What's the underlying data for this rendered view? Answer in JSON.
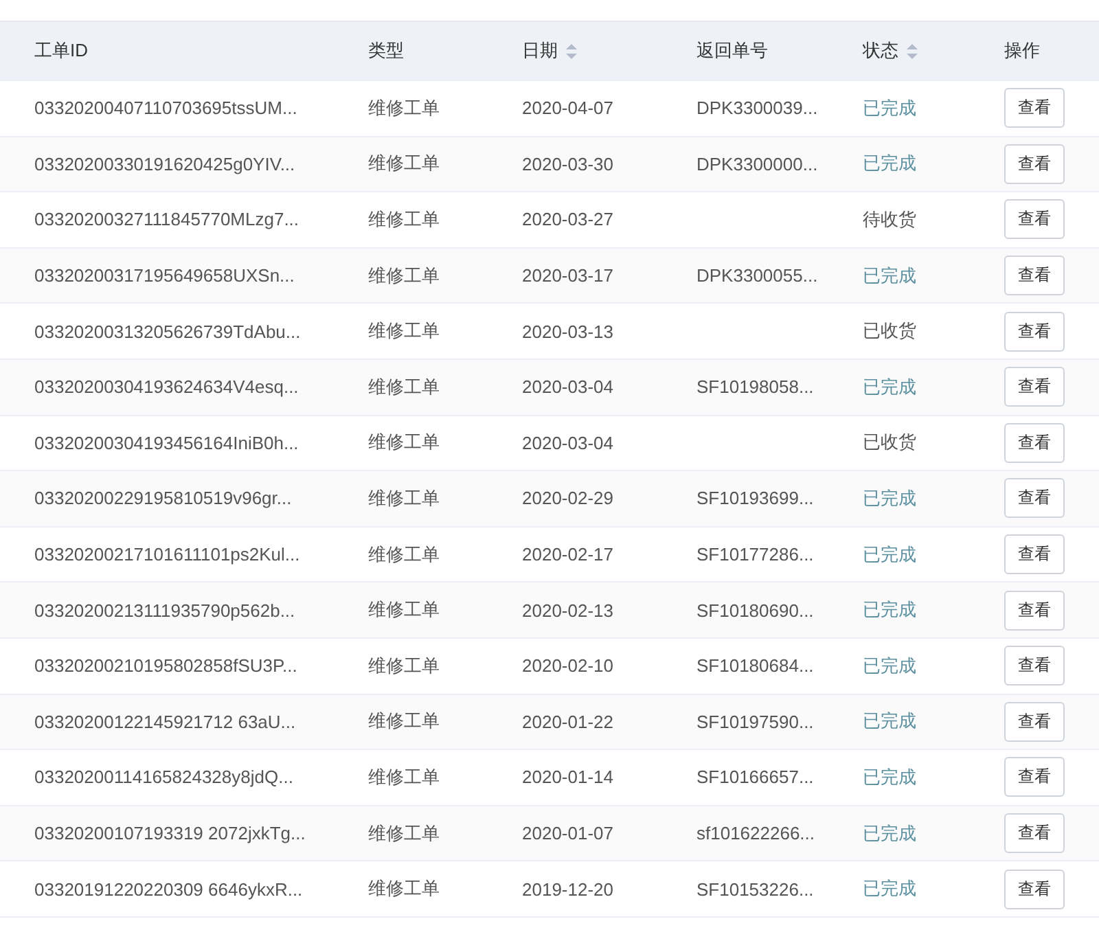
{
  "table": {
    "columns": [
      {
        "label": "工单ID",
        "sortable": false
      },
      {
        "label": "类型",
        "sortable": false
      },
      {
        "label": "日期",
        "sortable": true
      },
      {
        "label": "返回单号",
        "sortable": false
      },
      {
        "label": "状态",
        "sortable": true
      },
      {
        "label": "操作",
        "sortable": false
      }
    ],
    "rows": [
      {
        "id": "03320200407110703695tssUM...",
        "type": "维修工单",
        "date": "2020-04-07",
        "return_no": "DPK3300039...",
        "status": "已完成",
        "completed": true,
        "action": "查看"
      },
      {
        "id": "03320200330191620425g0YIV...",
        "type": "维修工单",
        "date": "2020-03-30",
        "return_no": "DPK3300000...",
        "status": "已完成",
        "completed": true,
        "action": "查看"
      },
      {
        "id": "03320200327111845770MLzg7...",
        "type": "维修工单",
        "date": "2020-03-27",
        "status": "待收货",
        "completed": false,
        "action": "查看"
      },
      {
        "id": "03320200317195649658UXSn...",
        "type": "维修工单",
        "date": "2020-03-17",
        "return_no": "DPK3300055...",
        "status": "已完成",
        "completed": true,
        "action": "查看"
      },
      {
        "id": "03320200313205626739TdAbu...",
        "type": "维修工单",
        "date": "2020-03-13",
        "status": "已收货",
        "completed": false,
        "action": "查看"
      },
      {
        "id": "03320200304193624634V4esq...",
        "type": "维修工单",
        "date": "2020-03-04",
        "return_no": "SF10198058...",
        "status": "已完成",
        "completed": true,
        "action": "查看"
      },
      {
        "id": "03320200304193456164IniB0h...",
        "type": "维修工单",
        "date": "2020-03-04",
        "status": "已收货",
        "completed": false,
        "action": "查看"
      },
      {
        "id": "03320200229195810519v96gr...",
        "type": "维修工单",
        "date": "2020-02-29",
        "return_no": "SF10193699...",
        "status": "已完成",
        "completed": true,
        "action": "查看"
      },
      {
        "id": "03320200217101611101ps2Kul...",
        "type": "维修工单",
        "date": "2020-02-17",
        "return_no": "SF10177286...",
        "status": "已完成",
        "completed": true,
        "action": "查看"
      },
      {
        "id": "03320200213111935790p562b...",
        "type": "维修工单",
        "date": "2020-02-13",
        "return_no": "SF10180690...",
        "status": "已完成",
        "completed": true,
        "action": "查看"
      },
      {
        "id": "03320200210195802858fSU3P...",
        "type": "维修工单",
        "date": "2020-02-10",
        "return_no": "SF10180684...",
        "status": "已完成",
        "completed": true,
        "action": "查看"
      },
      {
        "id": "03320200122145921712 63aU...",
        "type": "维修工单",
        "date": "2020-01-22",
        "return_no": "SF10197590...",
        "status": "已完成",
        "completed": true,
        "action": "查看"
      },
      {
        "id": "03320200114165824328y8jdQ...",
        "type": "维修工单",
        "date": "2020-01-14",
        "return_no": "SF10166657...",
        "status": "已完成",
        "completed": true,
        "action": "查看"
      },
      {
        "id": "03320200107193319 2072jxkTg...",
        "type": "维修工单",
        "date": "2020-01-07",
        "return_no": "sf101622266...",
        "status": "已完成",
        "completed": true,
        "action": "查看"
      },
      {
        "id": "03320191220220309 6646ykxR...",
        "type": "维修工单",
        "date": "2019-12-20",
        "return_no": "SF10153226...",
        "status": "已完成",
        "completed": true,
        "action": "查看"
      }
    ]
  }
}
